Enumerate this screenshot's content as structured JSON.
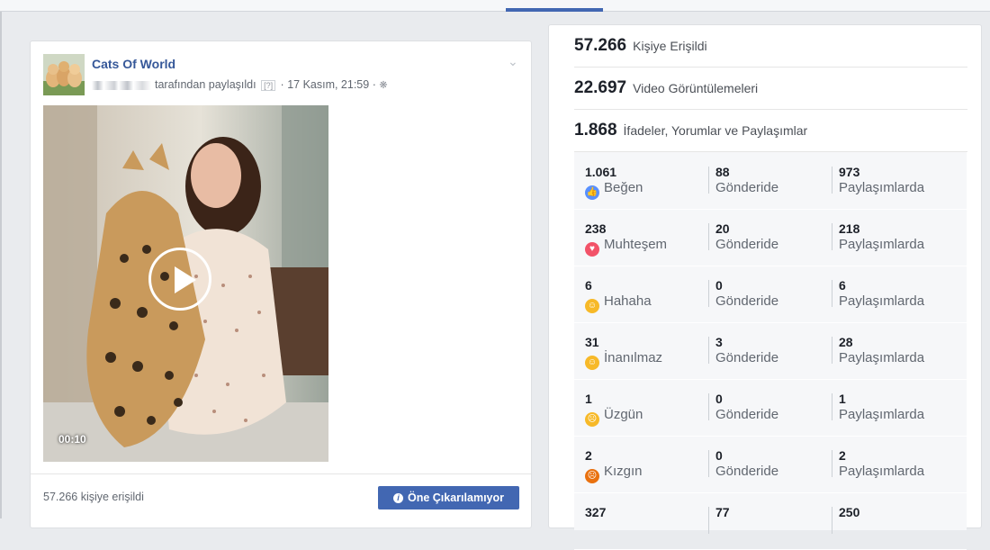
{
  "post": {
    "page_name": "Cats Of World",
    "shared_by_suffix": "tarafından paylaşıldı",
    "help_badge": "[?]",
    "date": "17 Kasım, 21:59",
    "video_duration": "00:10",
    "reach_text": "57.266 kişiye erişildi",
    "boost_label": "Öne Çıkarılamıyor"
  },
  "insights": {
    "stats": [
      {
        "value": "57.266",
        "label": "Kişiye Erişildi"
      },
      {
        "value": "22.697",
        "label": "Video Görüntülemeleri"
      },
      {
        "value": "1.868",
        "label": "İfadeler, Yorumlar ve Paylaşımlar"
      }
    ],
    "breakdown": [
      {
        "total": "1.061",
        "reaction": "Beğen",
        "icon": "like-icon",
        "color": "#5890ff",
        "posts_value": "88",
        "posts_label": "Gönderide",
        "shares_value": "973",
        "shares_label": "Paylaşımlarda"
      },
      {
        "total": "238",
        "reaction": "Muhteşem",
        "icon": "love-icon",
        "color": "#f25268",
        "posts_value": "20",
        "posts_label": "Gönderide",
        "shares_value": "218",
        "shares_label": "Paylaşımlarda"
      },
      {
        "total": "6",
        "reaction": "Hahaha",
        "icon": "haha-icon",
        "color": "#f7b928",
        "posts_value": "0",
        "posts_label": "Gönderide",
        "shares_value": "6",
        "shares_label": "Paylaşımlarda"
      },
      {
        "total": "31",
        "reaction": "İnanılmaz",
        "icon": "wow-icon",
        "color": "#f7b928",
        "posts_value": "3",
        "posts_label": "Gönderide",
        "shares_value": "28",
        "shares_label": "Paylaşımlarda"
      },
      {
        "total": "1",
        "reaction": "Üzgün",
        "icon": "sad-icon",
        "color": "#f7b928",
        "posts_value": "0",
        "posts_label": "Gönderide",
        "shares_value": "1",
        "shares_label": "Paylaşımlarda"
      },
      {
        "total": "2",
        "reaction": "Kızgın",
        "icon": "angry-icon",
        "color": "#e9710f",
        "posts_value": "0",
        "posts_label": "Gönderide",
        "shares_value": "2",
        "shares_label": "Paylaşımlarda"
      },
      {
        "total": "327",
        "reaction": "",
        "icon": "",
        "color": "",
        "posts_value": "77",
        "posts_label": "",
        "shares_value": "250",
        "shares_label": ""
      }
    ]
  }
}
